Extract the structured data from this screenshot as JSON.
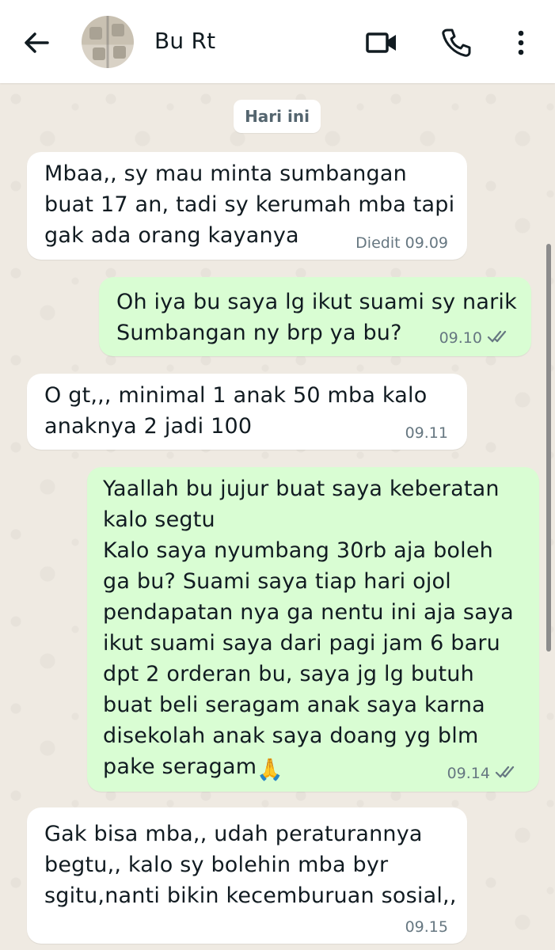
{
  "header": {
    "contact_name": "Bu Rt",
    "back_icon": "arrow-left-icon",
    "video_icon": "video-call-icon",
    "call_icon": "phone-icon",
    "menu_icon": "more-vert-icon"
  },
  "date_chip": "Hari ini",
  "messages": [
    {
      "direction": "in",
      "text": "Mbaa,, sy mau minta sumbangan\nbuat 17 an, tadi sy kerumah mba tapi\ngak ada orang kayanya",
      "meta": "Diedit 09.09"
    },
    {
      "direction": "out",
      "text": "Oh iya bu saya lg ikut suami sy narik\nSumbangan ny brp ya bu?",
      "meta": "09.10"
    },
    {
      "direction": "in",
      "text": "O gt,,, minimal 1 anak 50 mba kalo\nanaknya 2 jadi 100",
      "meta": "09.11"
    },
    {
      "direction": "out",
      "text": "Yaallah bu jujur buat saya keberatan\nkalo segtu\nKalo saya nyumbang 30rb aja boleh\nga bu? Suami saya tiap hari ojol\npendapatan nya ga nentu ini aja saya\nikut suami saya dari pagi jam 6 baru\ndpt 2 orderan bu, saya jg lg butuh\nbuat beli seragam anak saya karna\ndisekolah anak saya doang yg blm\npake seragam",
      "emoji": "🙏",
      "meta": "09.14"
    },
    {
      "direction": "in",
      "text": "Gak bisa mba,, udah peraturannya\nbegtu,, kalo sy bolehin mba byr\nsgitu,nanti bikin kecemburuan sosial,,",
      "meta": "09.15"
    }
  ],
  "colors": {
    "incoming_bubble": "#ffffff",
    "outgoing_bubble": "#d9fdd3",
    "chat_background": "#efeae2",
    "read_ticks": "#667781"
  }
}
